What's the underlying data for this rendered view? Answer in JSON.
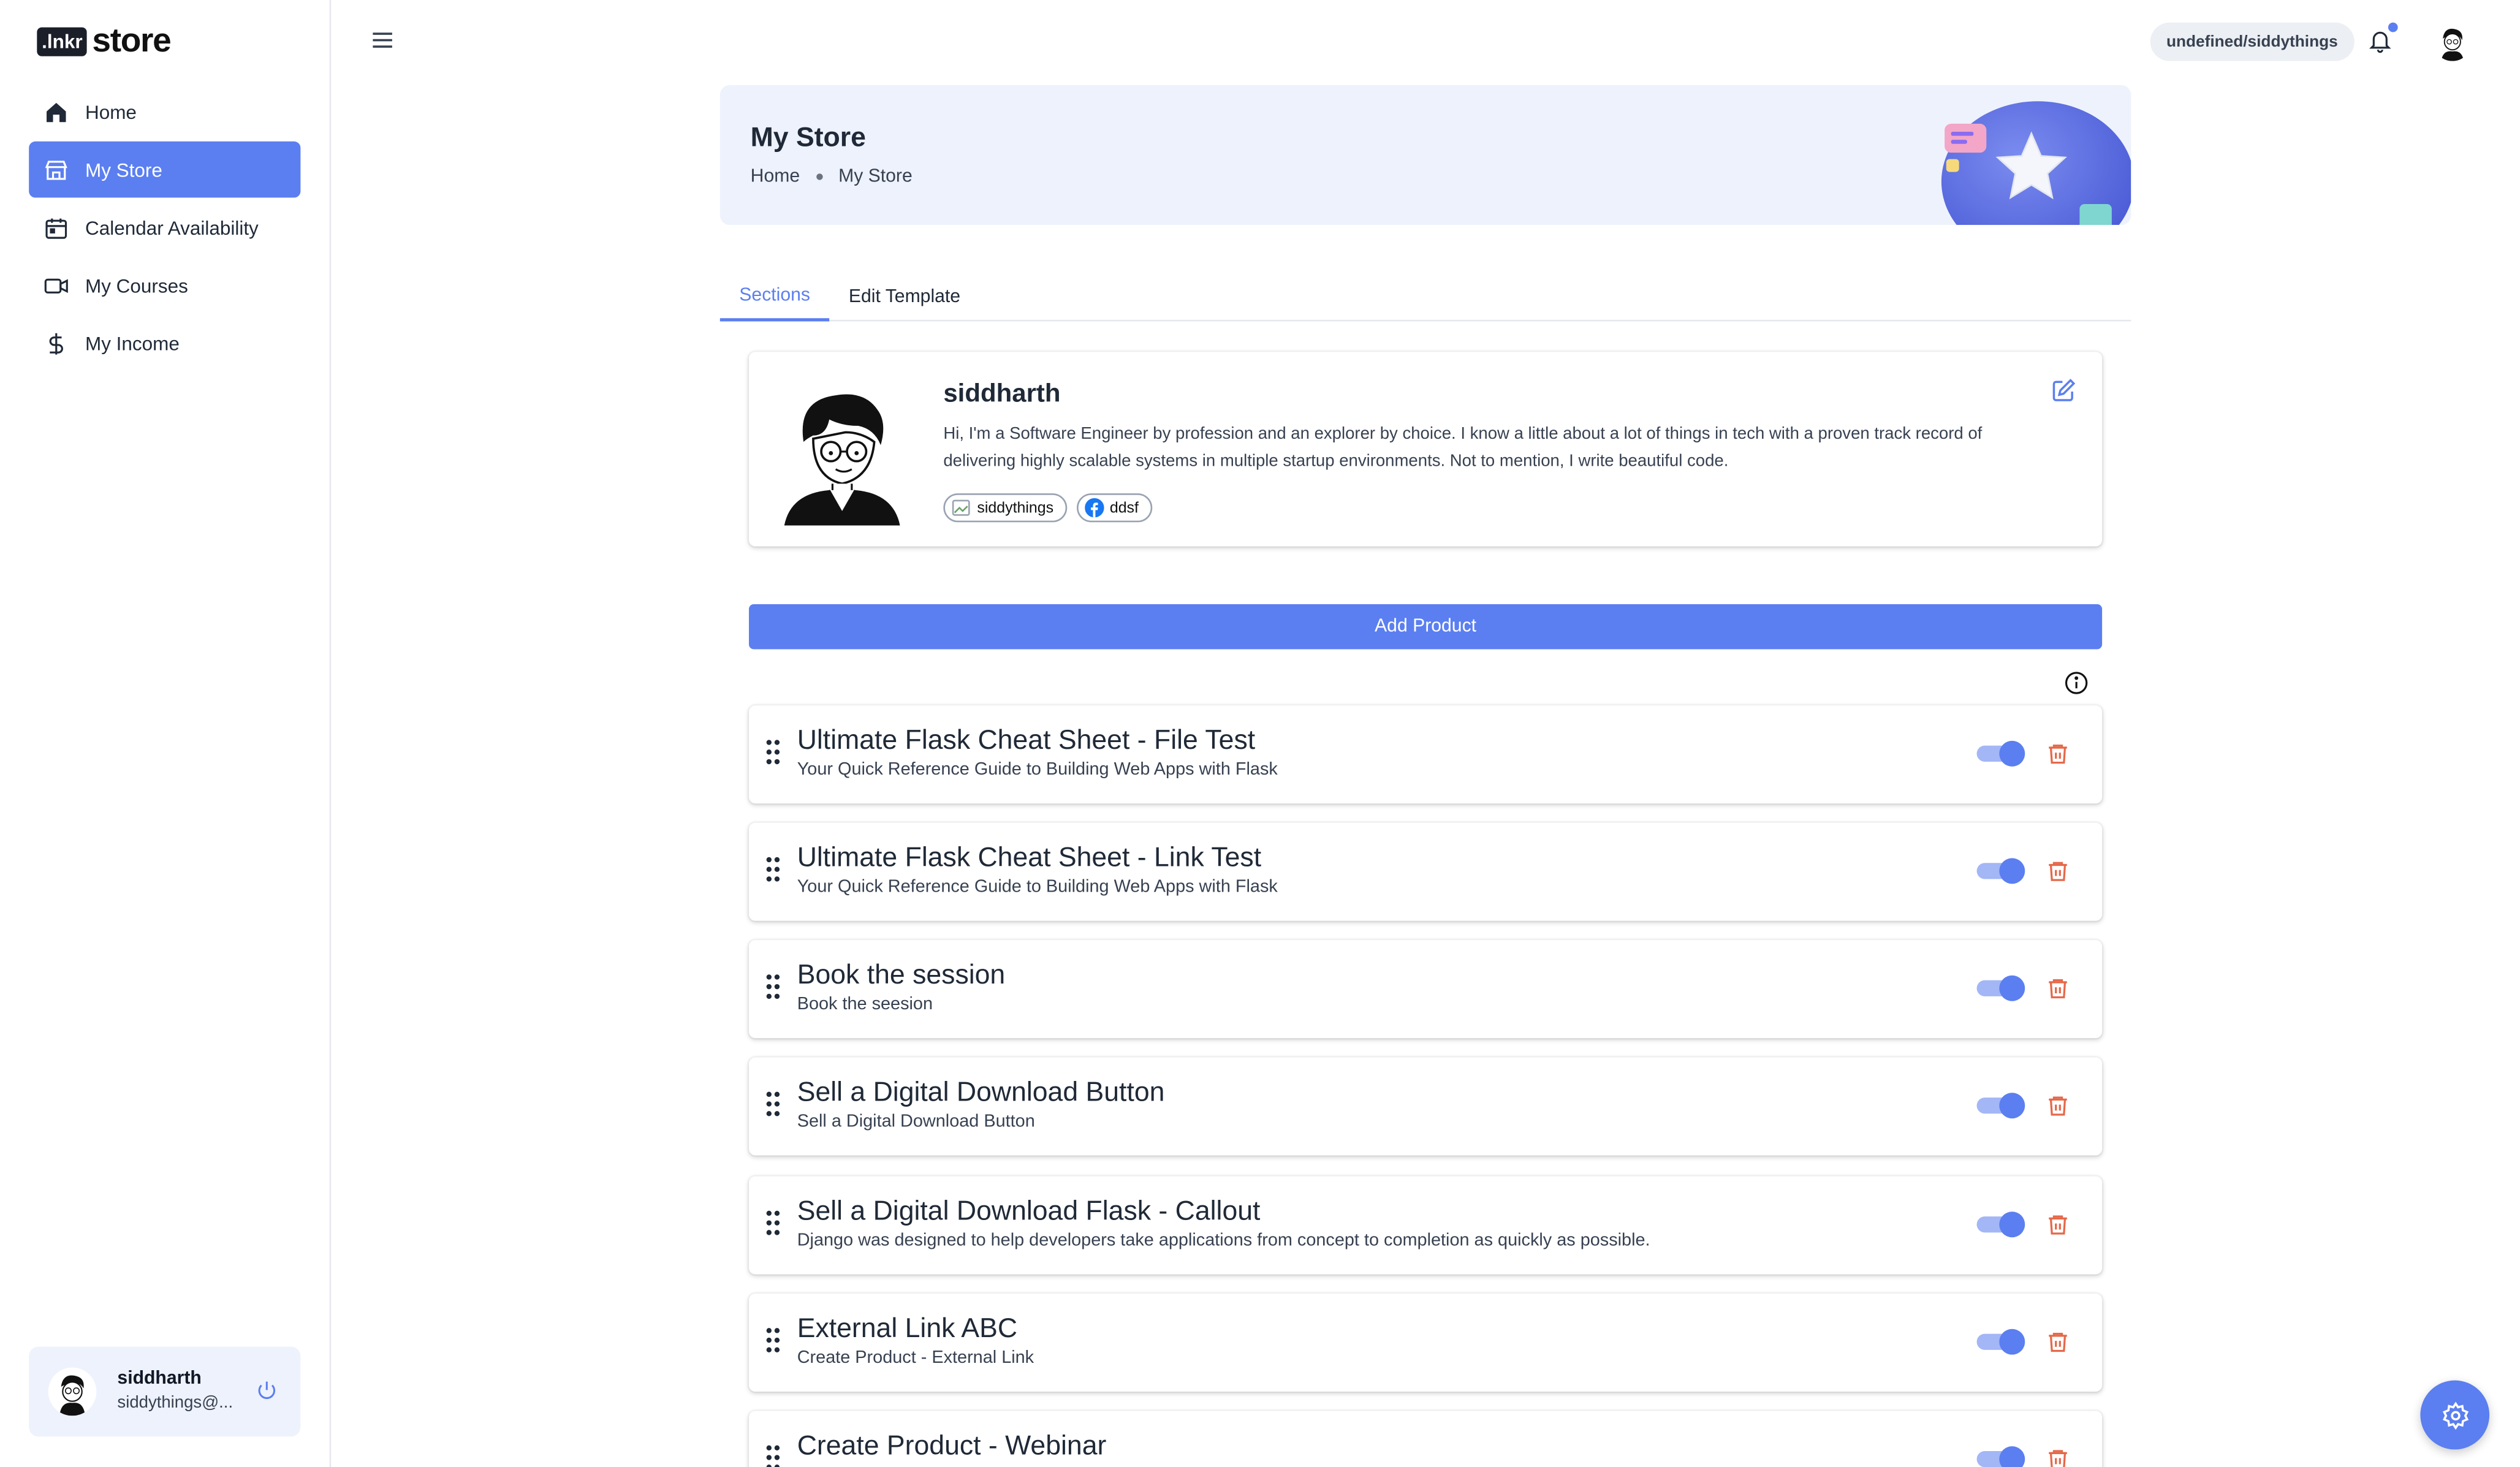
{
  "brand": {
    "badge": ".lnkr",
    "name": "store"
  },
  "sidebar": {
    "items": [
      {
        "label": "Home",
        "icon": "home-icon",
        "active": false
      },
      {
        "label": "My Store",
        "icon": "store-icon",
        "active": true
      },
      {
        "label": "Calendar Availability",
        "icon": "calendar-icon",
        "active": false
      },
      {
        "label": "My Courses",
        "icon": "video-icon",
        "active": false
      },
      {
        "label": "My Income",
        "icon": "dollar-icon",
        "active": false
      }
    ],
    "user": {
      "name": "siddharth",
      "email": "siddythings@..."
    }
  },
  "topbar": {
    "handle": "undefined/siddythings"
  },
  "header": {
    "title": "My Store",
    "breadcrumb": [
      "Home",
      "My Store"
    ]
  },
  "tabs": [
    "Sections",
    "Edit Template"
  ],
  "profile": {
    "name": "siddharth",
    "bio": "Hi, I'm a Software Engineer by profession and an explorer by choice. I know a little about a lot of things in tech with a proven track record of delivering highly scalable systems in multiple startup environments. Not to mention, I write beautiful code.",
    "links": [
      {
        "label": "siddythings",
        "icon": "broken-image-icon"
      },
      {
        "label": "ddsf",
        "icon": "facebook-icon"
      }
    ]
  },
  "add_product_label": "Add Product",
  "products": [
    {
      "title": "Ultimate Flask Cheat Sheet - File Test",
      "subtitle": "Your Quick Reference Guide to Building Web Apps with Flask",
      "enabled": true
    },
    {
      "title": "Ultimate Flask Cheat Sheet - Link Test",
      "subtitle": "Your Quick Reference Guide to Building Web Apps with Flask",
      "enabled": true
    },
    {
      "title": "Book the session",
      "subtitle": "Book the seesion",
      "enabled": true
    },
    {
      "title": "Sell a Digital Download Button",
      "subtitle": "Sell a Digital Download Button",
      "enabled": true
    },
    {
      "title": "Sell a Digital Download Flask - Callout",
      "subtitle": "Django was designed to help developers take applications from concept to completion as quickly as possible.",
      "enabled": true
    },
    {
      "title": "External Link ABC",
      "subtitle": "Create Product - External Link",
      "enabled": true
    },
    {
      "title": "Create Product - Webinar",
      "subtitle": "",
      "enabled": true
    }
  ],
  "colors": {
    "accent": "#5b7ff0",
    "danger": "#e5694a",
    "banner_bg": "#eef2fc"
  }
}
